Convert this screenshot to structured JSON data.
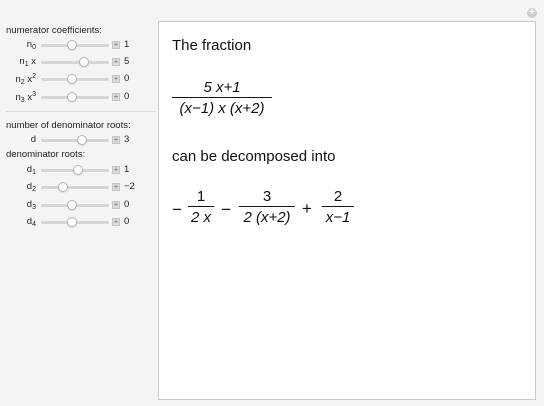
{
  "panel": {
    "numerator_heading": "numerator coefficients:",
    "numerator_rows": [
      {
        "label": "n",
        "sub": "0",
        "var": "",
        "sup": "",
        "value": "1",
        "level": 0.45
      },
      {
        "label": "n",
        "sub": "1",
        "var": "x",
        "sup": "",
        "value": "5",
        "level": 0.65
      },
      {
        "label": "n",
        "sub": "2",
        "var": "x",
        "sup": "2",
        "value": "0",
        "level": 0.45
      },
      {
        "label": "n",
        "sub": "3",
        "var": "x",
        "sup": "3",
        "value": "0",
        "level": 0.45
      }
    ],
    "num_roots_heading": "number of denominator roots:",
    "num_roots_row": {
      "label": "d",
      "value": "3",
      "level": 0.62
    },
    "roots_heading": "denominator roots:",
    "root_rows": [
      {
        "label": "d",
        "sub": "1",
        "value": "1",
        "level": 0.55
      },
      {
        "label": "d",
        "sub": "2",
        "value": "−2",
        "level": 0.3
      },
      {
        "label": "d",
        "sub": "3",
        "value": "0",
        "level": 0.45
      },
      {
        "label": "d",
        "sub": "4",
        "value": "0",
        "level": 0.45
      }
    ],
    "plus_symbol": "+"
  },
  "main": {
    "intro": "The fraction",
    "fraction": {
      "numerator": "5 x+1",
      "denominator": "(x−1) x (x+2)"
    },
    "middle": "can be decomposed into",
    "result": {
      "sign1": "−",
      "term1": {
        "numerator": "1",
        "denominator": "2 x"
      },
      "sign2": "−",
      "term2": {
        "numerator": "3",
        "denominator": "2 (x+2)"
      },
      "sign3": "+",
      "term3": {
        "numerator": "2",
        "denominator": "x−1"
      }
    }
  },
  "corner_button": "+"
}
